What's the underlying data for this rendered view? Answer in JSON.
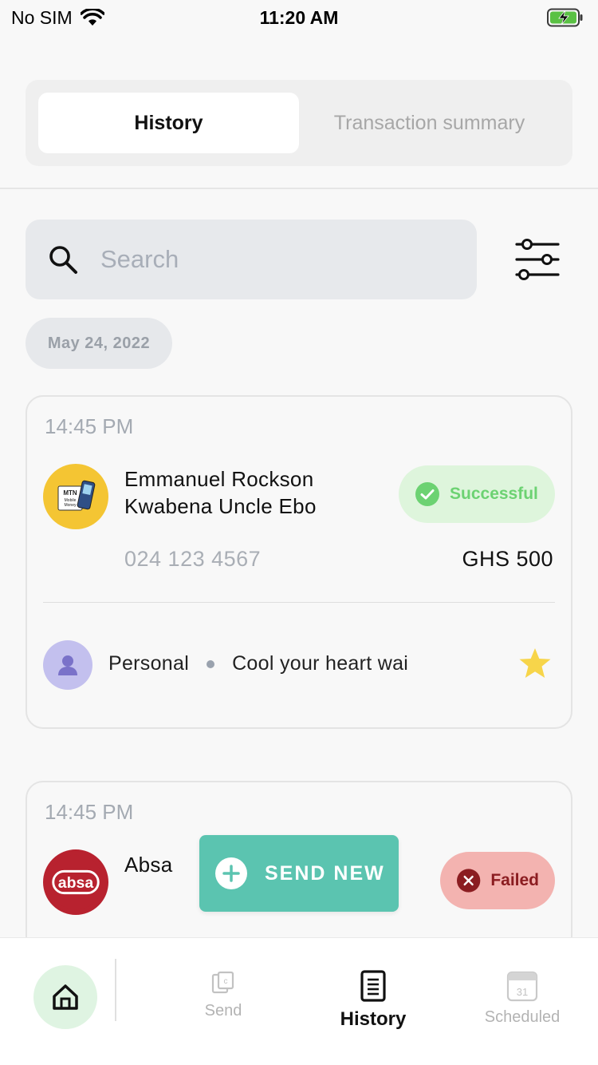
{
  "status_bar": {
    "carrier": "No SIM",
    "time": "11:20 AM"
  },
  "tabs": [
    {
      "label": "History",
      "active": true
    },
    {
      "label": "Transaction summary",
      "active": false
    }
  ],
  "search": {
    "placeholder": "Search"
  },
  "date_group": "May 24, 2022",
  "transactions": [
    {
      "time": "14:45 PM",
      "name_line1": "Emmanuel Rockson",
      "name_line2": "Kwabena Uncle Ebo",
      "provider_icon": "mtn-mobile-money-logo",
      "status": "Successful",
      "phone": "024 123 4567",
      "amount": "GHS 500",
      "category": "Personal",
      "note": "Cool your heart wai",
      "favorite": true
    },
    {
      "time": "14:45 PM",
      "name_line1": "Absa",
      "provider_icon": "absa-logo",
      "logo_text": "absa",
      "status": "Failed"
    }
  ],
  "fab": {
    "label": "SEND NEW"
  },
  "bottom_nav": {
    "send": "Send",
    "history": "History",
    "scheduled": "Scheduled",
    "calendar_day": "31"
  },
  "colors": {
    "accent_teal": "#5bc4b0",
    "success_bg": "#def5dc",
    "success_text": "#6cd272",
    "failed_bg": "#f3b3b0",
    "failed_text": "#8b1d21",
    "star": "#f7d54a"
  }
}
